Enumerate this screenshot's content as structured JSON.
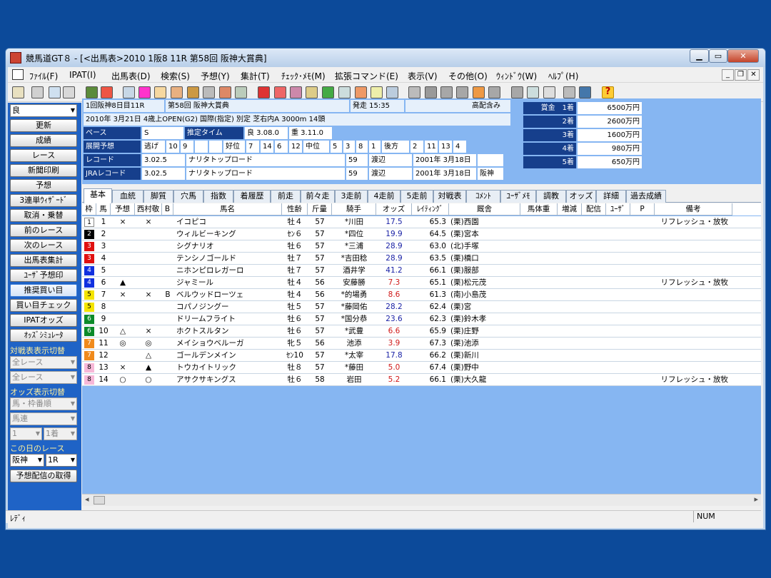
{
  "window": {
    "title": "競馬道GT８ - [<出馬表>2010 1阪8 11R 第58回 阪神大賞典]",
    "min": "▁",
    "max": "▭",
    "close": "✕"
  },
  "menu": [
    "ﾌｧｲﾙ(F)",
    "IPAT(I)",
    "出馬表(D)",
    "検索(S)",
    "予想(Y)",
    "集計(T)",
    "ﾁｪｯｸ･ﾒﾓ(M)",
    "拡張コマンド(E)",
    "表示(V)",
    "その他(O)",
    "ｳｨﾝﾄﾞｳ(W)",
    "ﾍﾙﾌﾟ(H)"
  ],
  "mdi": {
    "min": "_",
    "restore": "❐",
    "close": "✕"
  },
  "left": {
    "condition": "良",
    "buttons": [
      "更新",
      "成績",
      "レース",
      "新聞印刷",
      "予想",
      "3連単ｳｨｻﾞｰﾄﾞ",
      "取消・乗替",
      "前のレース",
      "次のレース",
      "出馬表集計",
      "ﾕｰｻﾞ予想印",
      "推奨買い目",
      "買い目チェック",
      "IPATオッズ",
      "ｵｯｽﾞｼﾐｭﾚｰﾀ"
    ],
    "label_battle": "対戦表表示切替",
    "all_race1": "全レース",
    "all_race2": "全レース",
    "label_odds": "オッズ表示切替",
    "odds_sort": "馬・枠番順",
    "odds_type": "馬連",
    "odds_n1": "1",
    "odds_n2": "1着",
    "label_today": "この日のレース",
    "venue": "阪神",
    "race_no": "1R",
    "fetch": "予想配信の取得"
  },
  "info": {
    "r1a": "1回阪神8日目11R",
    "r1b": "第58回 阪神大賞典",
    "r1c": "発走 15:35",
    "r1d": "高配含み",
    "r2": "2010年 3月21日 4歳上OPEN(G2) 国際(指定) 別定 芝右内A 3000m 14頭",
    "pace_l": "ペース",
    "pace_v": "S",
    "est_l": "推定タイム",
    "est1": "良 3.08.0",
    "est2": "重 3.11.0",
    "dev_l": "展開予想",
    "esc": "逃げ",
    "e1": "10",
    "e2": "9",
    "good": "好位",
    "g1": "7",
    "g2": "14",
    "g3": "6",
    "g4": "12",
    "mid": "中位",
    "m1": "5",
    "m2": "3",
    "m3": "8",
    "m4": "1",
    "back": "後方",
    "b1": "2",
    "b2": "11",
    "b3": "13",
    "b4": "4",
    "rec_l": "レコード",
    "rec_t": "3.02.5",
    "rec_h": "ナリタトップロード",
    "rec_w": "59",
    "rec_j": "渡辺",
    "rec_d": "2001年 3月18日",
    "rec_p": "",
    "jra_l": "JRAレコード",
    "jra_t": "3.02.5",
    "jra_h": "ナリタトップロード",
    "jra_w": "59",
    "jra_j": "渡辺",
    "jra_d": "2001年 3月18日",
    "jra_p": "阪神",
    "prize_l": [
      "賞金　1着",
      "2着",
      "3着",
      "4着",
      "5着"
    ],
    "prize_v": [
      "6500万円",
      "2600万円",
      "1600万円",
      "980万円",
      "650万円"
    ]
  },
  "tabs": [
    "基本",
    "血統",
    "脚質",
    "穴馬",
    "指数",
    "着履歴",
    "前走",
    "前々走",
    "3走前",
    "4走前",
    "5走前",
    "対戦表",
    "ｺﾒﾝﾄ",
    "ﾕｰｻﾞﾒﾓ",
    "調教",
    "オッズ",
    "詳細",
    "過去成績"
  ],
  "headers": [
    "枠",
    "馬",
    "予想",
    "西村敬",
    "B",
    "馬名",
    "性齢",
    "斤量",
    "騎手",
    "オッズ",
    "ﾚｲﾃｨﾝｸﾞ",
    "厩舎",
    "馬体重",
    "増減",
    "配信",
    "ﾕｰｻﾞ",
    "P",
    "備考"
  ],
  "rows": [
    {
      "waku": "1",
      "uma": "1",
      "yoso": "×",
      "nishi": "×",
      "b": "",
      "name": "イコピコ",
      "sex": "牡４",
      "kin": "57",
      "jockey": "*川田",
      "odds": "17.5",
      "rating": "65.3",
      "stable": "(栗)西園",
      "note": "リフレッシュ・放牧",
      "wcol": "#ffffff",
      "wtxt": "#000000",
      "ocol": "#1a22a6"
    },
    {
      "waku": "2",
      "uma": "2",
      "yoso": "",
      "nishi": "",
      "b": "",
      "name": "ウィルビーキング",
      "sex": "ｾﾝ６",
      "kin": "57",
      "jockey": "*四位",
      "odds": "19.9",
      "rating": "64.5",
      "stable": "(栗)宮本",
      "note": "",
      "wcol": "#000000",
      "wtxt": "#ffffff",
      "ocol": "#1a22a6"
    },
    {
      "waku": "3",
      "uma": "3",
      "yoso": "",
      "nishi": "",
      "b": "",
      "name": "シグナリオ",
      "sex": "牡６",
      "kin": "57",
      "jockey": "*三浦",
      "odds": "28.9",
      "rating": "63.0",
      "stable": "(北)手塚",
      "note": "",
      "wcol": "#e01010",
      "wtxt": "#ffffff",
      "ocol": "#1a22a6"
    },
    {
      "waku": "3",
      "uma": "4",
      "yoso": "",
      "nishi": "",
      "b": "",
      "name": "テンシノゴールド",
      "sex": "牡７",
      "kin": "57",
      "jockey": "*吉田稔",
      "odds": "28.9",
      "rating": "63.5",
      "stable": "(栗)橋口",
      "note": "",
      "wcol": "#e01010",
      "wtxt": "#ffffff",
      "ocol": "#1a22a6"
    },
    {
      "waku": "4",
      "uma": "5",
      "yoso": "",
      "nishi": "",
      "b": "",
      "name": "ニホンピロレガーロ",
      "sex": "牡７",
      "kin": "57",
      "jockey": "酒井学",
      "odds": "41.2",
      "rating": "66.1",
      "stable": "(栗)服部",
      "note": "",
      "wcol": "#1030e0",
      "wtxt": "#ffffff",
      "ocol": "#1a22a6"
    },
    {
      "waku": "4",
      "uma": "6",
      "yoso": "▲",
      "nishi": "",
      "b": "",
      "name": "ジャミール",
      "sex": "牡４",
      "kin": "56",
      "jockey": "安藤勝",
      "odds": "7.3",
      "rating": "65.1",
      "stable": "(栗)松元茂",
      "note": "リフレッシュ・放牧",
      "wcol": "#1030e0",
      "wtxt": "#ffffff",
      "ocol": "#d01818"
    },
    {
      "waku": "5",
      "uma": "7",
      "yoso": "×",
      "nishi": "×",
      "b": "B",
      "name": "ベルウッドローツェ",
      "sex": "牡４",
      "kin": "56",
      "jockey": "*的場勇",
      "odds": "8.6",
      "rating": "61.3",
      "stable": "(南)小島茂",
      "note": "",
      "wcol": "#f4e400",
      "wtxt": "#000000",
      "ocol": "#d01818"
    },
    {
      "waku": "5",
      "uma": "8",
      "yoso": "",
      "nishi": "",
      "b": "",
      "name": "コパノジングー",
      "sex": "牡５",
      "kin": "57",
      "jockey": "*藤岡佑",
      "odds": "28.2",
      "rating": "62.4",
      "stable": "(栗)宮",
      "note": "",
      "wcol": "#f4e400",
      "wtxt": "#000000",
      "ocol": "#1a22a6"
    },
    {
      "waku": "6",
      "uma": "9",
      "yoso": "",
      "nishi": "",
      "b": "",
      "name": "ドリームフライト",
      "sex": "牡６",
      "kin": "57",
      "jockey": "*国分恭",
      "odds": "23.6",
      "rating": "62.3",
      "stable": "(栗)鈴木孝",
      "note": "",
      "wcol": "#0c8a2a",
      "wtxt": "#ffffff",
      "ocol": "#1a22a6"
    },
    {
      "waku": "6",
      "uma": "10",
      "yoso": "△",
      "nishi": "×",
      "b": "",
      "name": "ホクトスルタン",
      "sex": "牡６",
      "kin": "57",
      "jockey": "*武豊",
      "odds": "6.6",
      "rating": "65.9",
      "stable": "(栗)庄野",
      "note": "",
      "wcol": "#0c8a2a",
      "wtxt": "#ffffff",
      "ocol": "#d01818"
    },
    {
      "waku": "7",
      "uma": "11",
      "yoso": "◎",
      "nishi": "◎",
      "b": "",
      "name": "メイショウベルーガ",
      "sex": "牝５",
      "kin": "56",
      "jockey": "池添",
      "odds": "3.9",
      "rating": "67.3",
      "stable": "(栗)池添",
      "note": "",
      "wcol": "#f08a1c",
      "wtxt": "#ffffff",
      "ocol": "#d01818"
    },
    {
      "waku": "7",
      "uma": "12",
      "yoso": "",
      "nishi": "△",
      "b": "",
      "name": "ゴールデンメイン",
      "sex": "ｾﾝ10",
      "kin": "57",
      "jockey": "*太宰",
      "odds": "17.8",
      "rating": "66.2",
      "stable": "(栗)新川",
      "note": "",
      "wcol": "#f08a1c",
      "wtxt": "#ffffff",
      "ocol": "#1a22a6"
    },
    {
      "waku": "8",
      "uma": "13",
      "yoso": "×",
      "nishi": "▲",
      "b": "",
      "name": "トウカイトリック",
      "sex": "牡８",
      "kin": "57",
      "jockey": "*藤田",
      "odds": "5.0",
      "rating": "67.4",
      "stable": "(栗)野中",
      "note": "",
      "wcol": "#f7b8d8",
      "wtxt": "#000000",
      "ocol": "#d01818"
    },
    {
      "waku": "8",
      "uma": "14",
      "yoso": "○",
      "nishi": "○",
      "b": "",
      "name": "アサクサキングス",
      "sex": "牡６",
      "kin": "58",
      "jockey": "岩田",
      "odds": "5.2",
      "rating": "66.1",
      "stable": "(栗)大久龍",
      "note": "リフレッシュ・放牧",
      "wcol": "#f7b8d8",
      "wtxt": "#000000",
      "ocol": "#d01818"
    }
  ],
  "hscroll": {
    "left": "◂",
    "right": "▸"
  },
  "status": {
    "left": "ﾚﾃﾞｨ",
    "num": "NUM"
  }
}
